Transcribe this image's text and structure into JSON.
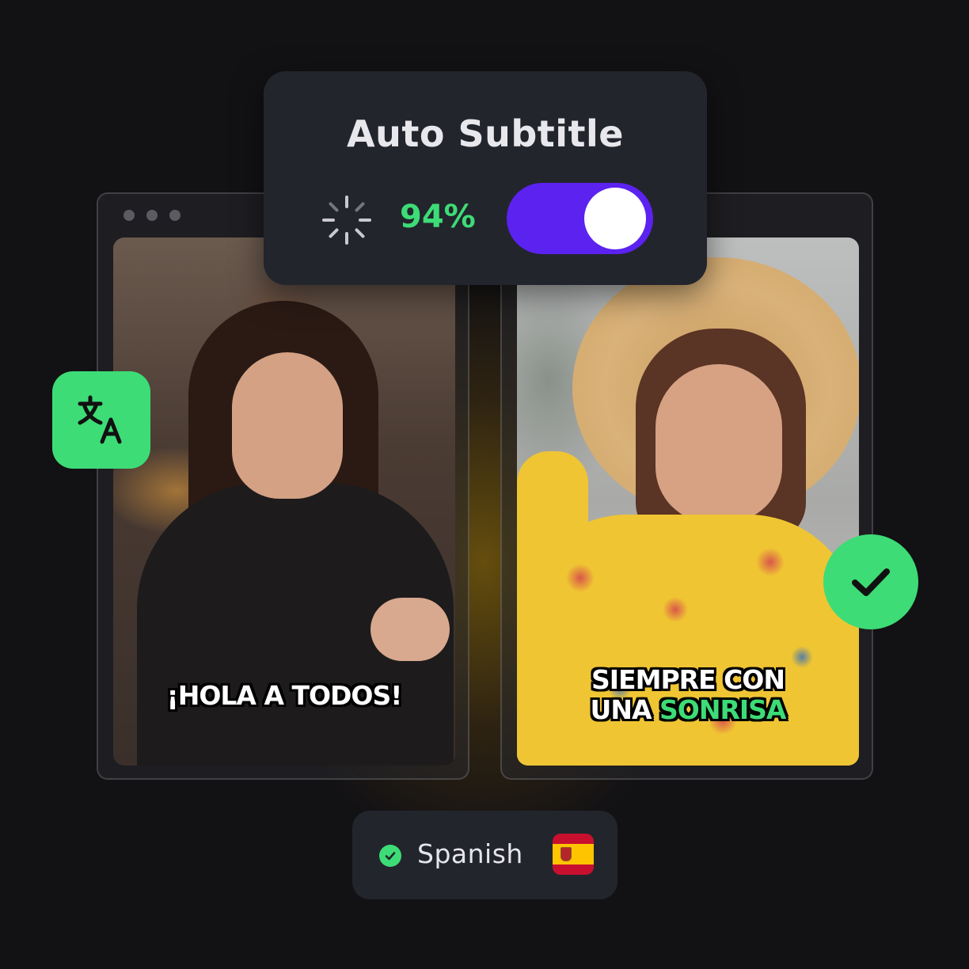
{
  "panel": {
    "title": "Auto Subtitle",
    "progress_text": "94%",
    "progress": 0.94,
    "toggle_on": true
  },
  "captions": {
    "left": "¡HOLA A TODOS!",
    "right_line1": "SIEMPRE CON",
    "right_line2_plain": "UNA ",
    "right_line2_highlight": "SONRISA"
  },
  "language": {
    "label": "Spanish",
    "flag": "spain-flag-icon",
    "selected": true
  },
  "icons": {
    "translate": "translate-icon",
    "check": "check-circle-icon",
    "spinner": "loading-spinner-icon"
  },
  "colors": {
    "background": "#121114",
    "accent_green": "#3ddc76",
    "toggle_purple": "#5b22f0",
    "panel": "#23252d"
  }
}
